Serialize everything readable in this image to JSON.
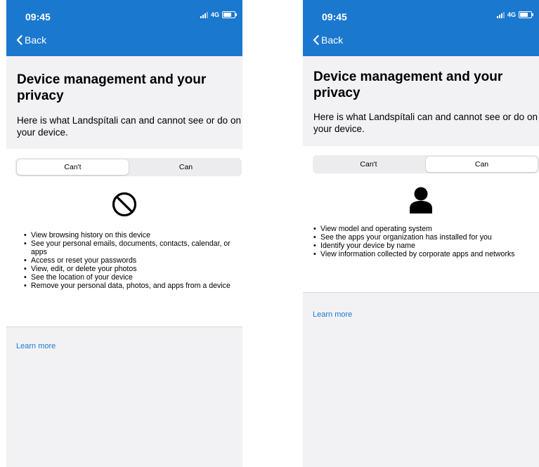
{
  "screens": [
    {
      "status": {
        "time": "09:45",
        "network": "4G"
      },
      "nav": {
        "back_label": "Back"
      },
      "title": "Device management and your privacy",
      "description": "Here is what Landspítali can and cannot see or do on your device.",
      "tabs": [
        {
          "label": "Can't",
          "selected": true
        },
        {
          "label": "Can",
          "selected": false
        }
      ],
      "icon": "no-entry-icon",
      "items": [
        "View browsing history on this device",
        "See your personal emails, documents, contacts, calendar, or apps",
        "Access or reset your passwords",
        "View, edit, or delete your photos",
        "See the location of your device",
        "Remove your personal data, photos, and apps from a device"
      ],
      "learn_more": "Learn more"
    },
    {
      "status": {
        "time": "09:45",
        "network": "4G"
      },
      "nav": {
        "back_label": "Back"
      },
      "title": "Device management and your privacy",
      "description": "Here is what Landspítali can and cannot see or do on your device.",
      "tabs": [
        {
          "label": "Can't",
          "selected": false
        },
        {
          "label": "Can",
          "selected": true
        }
      ],
      "icon": "person-icon",
      "items": [
        "View model and operating system",
        "See the apps your organization has installed for you",
        "Identify your device by name",
        "View information collected by corporate apps and networks"
      ],
      "learn_more": "Learn more"
    }
  ],
  "colors": {
    "accent": "#1a78cf",
    "page_background": "#f2f2f5"
  }
}
